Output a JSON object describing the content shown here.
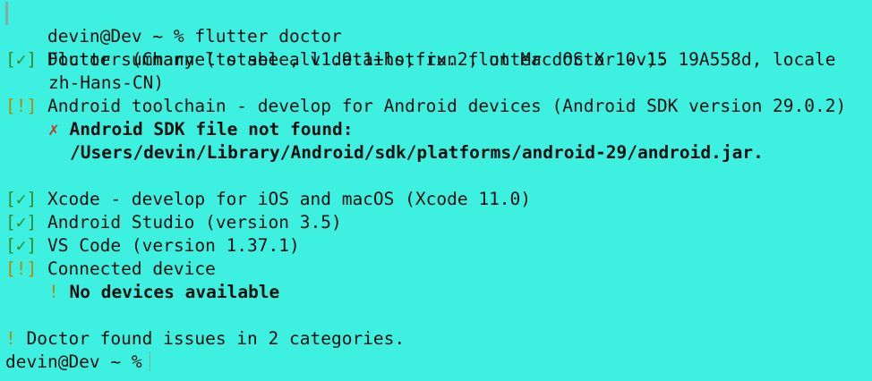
{
  "terminal": {
    "prompt1": "devin@Dev ~ % flutter doctor",
    "summary": "Doctor summary (to see all details, run flutter doctor -v):",
    "checks": [
      {
        "status": "[✓]",
        "text": "Flutter (Channel stable, v1.9.1+hotfix.2, on Mac OS X 10.15 19A558d, locale"
      },
      {
        "cont": "zh-Hans-CN)"
      },
      {
        "status": "[!]",
        "text": "Android toolchain - develop for Android devices (Android SDK version 29.0.2)"
      },
      {
        "sub_mark": "✗",
        "sub_text": "Android SDK file not found:"
      },
      {
        "cont": "/Users/devin/Library/Android/sdk/platforms/android-29/android.jar."
      },
      {
        "status": "[✓]",
        "text": "Xcode - develop for iOS and macOS (Xcode 11.0)"
      },
      {
        "status": "[✓]",
        "text": "Android Studio (version 3.5)"
      },
      {
        "status": "[✓]",
        "text": "VS Code (version 1.37.1)"
      },
      {
        "status": "[!]",
        "text": "Connected device"
      },
      {
        "sub_mark": "!",
        "sub_text": "No devices available"
      }
    ],
    "issues_mark": "!",
    "issues_text": "Doctor found issues in 2 categories.",
    "prompt2": "devin@Dev ~ %"
  },
  "colors": {
    "background": "#3ef0df",
    "ok": "#2e8b2e",
    "warn": "#b58a00",
    "error": "#c0392b"
  }
}
